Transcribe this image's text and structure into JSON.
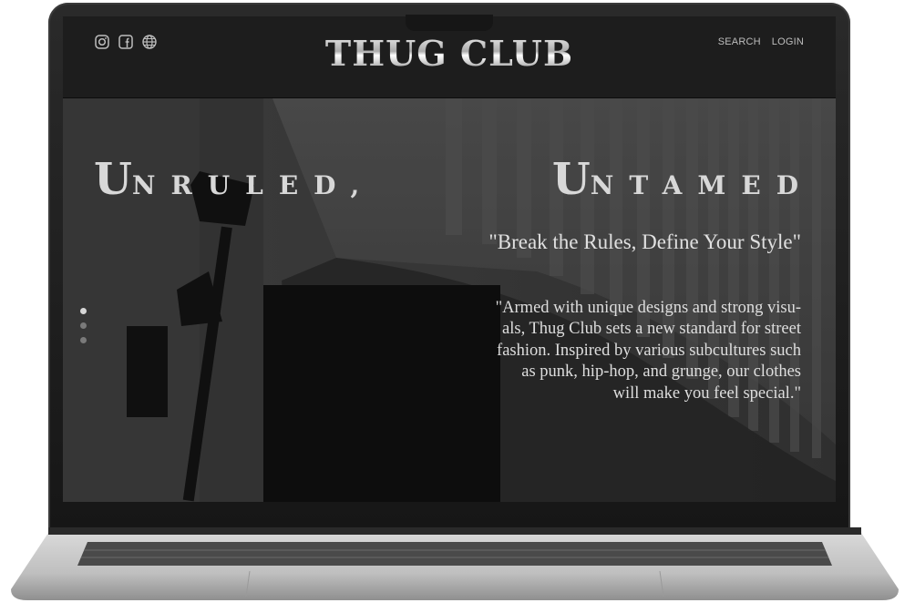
{
  "brand": {
    "logo_text": "THUG CLUB"
  },
  "nav": {
    "social_icons": [
      "instagram-icon",
      "facebook-icon",
      "globe-icon"
    ],
    "links": [
      "SEARCH",
      "LOGIN"
    ]
  },
  "hero": {
    "headline": [
      {
        "initial": "U",
        "rest": "nruled,"
      },
      {
        "initial": "U",
        "rest": "ntamed"
      }
    ],
    "tagline": "\"Break the Rules, Define Your Style\"",
    "description": "\"Armed with unique designs and strong visu-\nals, Thug Club sets a new standard for street\nfashion. Inspired by various subcultures such\nas punk, hip-hop, and grunge, our clothes\nwill make you feel special.\"",
    "slides": {
      "count": 3,
      "active_index": 0
    }
  },
  "colors": {
    "navbar": "#1d1d1d",
    "hero_overlay": "#2f2f2f",
    "text_light": "#dedede"
  }
}
